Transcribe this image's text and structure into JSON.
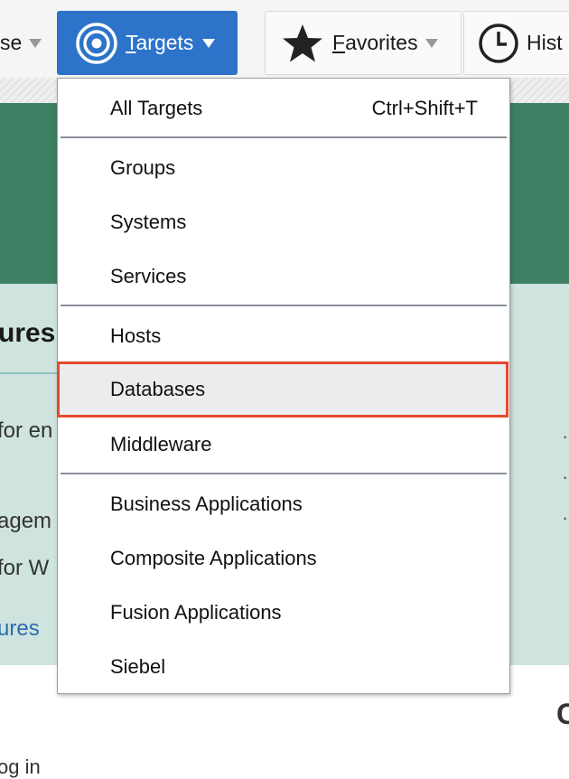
{
  "navbar": {
    "enterprise_fragment": "se",
    "targets_label": "Targets",
    "targets_accesskey": "T",
    "targets_rest": "argets",
    "favorites_accesskey": "F",
    "favorites_rest": "avorites",
    "history_fragment": "Hist"
  },
  "background": {
    "heading_fragment": "ures",
    "line1_fragment": "for en",
    "line2_fragment": "agem",
    "line3_fragment": "for W",
    "link_fragment": "ures",
    "login_fragment": "og in",
    "right_char": "C"
  },
  "menu": {
    "items": [
      {
        "label": "All Targets",
        "shortcut": "Ctrl+Shift+T"
      },
      {
        "label": "Groups"
      },
      {
        "label": "Systems"
      },
      {
        "label": "Services"
      },
      {
        "label": "Hosts"
      },
      {
        "label": "Databases",
        "selected": true
      },
      {
        "label": "Middleware"
      },
      {
        "label": "Business Applications"
      },
      {
        "label": "Composite Applications"
      },
      {
        "label": "Fusion Applications"
      },
      {
        "label": "Siebel"
      }
    ]
  },
  "colors": {
    "targets_button": "#2c73c9",
    "highlight_border": "#e54a2e",
    "banner": "#3d7f62",
    "panel": "#cfe3df"
  },
  "icons": [
    "caret-down-icon",
    "target-icon",
    "star-icon",
    "clock-icon"
  ]
}
